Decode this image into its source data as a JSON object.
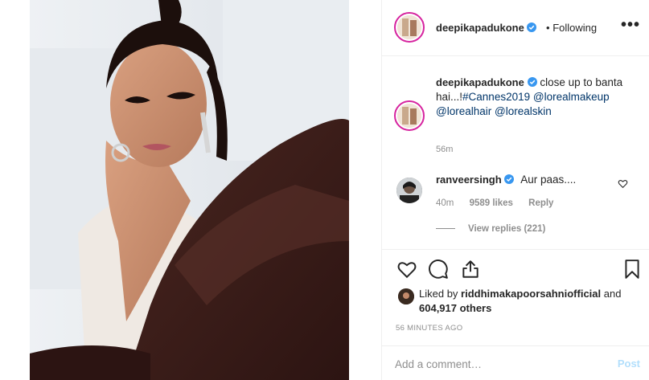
{
  "header": {
    "username": "deepikapadukone",
    "separator": "•",
    "follow_status": "Following",
    "more": "•••"
  },
  "caption": {
    "username": "deepikapadukone",
    "text": "close up to banta hai...!",
    "hashtag": "#Cannes2019",
    "mention1": "@lorealmakeup",
    "mention2": "@lorealhair",
    "mention3": "@lorealskin",
    "time": "56m"
  },
  "comment": {
    "username": "ranveersingh",
    "text": "Aur paas....",
    "time": "40m",
    "likes": "9589 likes",
    "reply": "Reply",
    "view_replies": "View replies (221)"
  },
  "likes": {
    "prefix": "Liked by",
    "user": "riddhimakapoorsahniofficial",
    "and": "and",
    "count": "604,917 others"
  },
  "post_age": "56 MINUTES AGO",
  "add_comment": {
    "placeholder": "Add a comment…",
    "post_label": "Post"
  },
  "colors": {
    "verified": "#3897f0",
    "link": "#003569",
    "post_button_disabled": "#b2dffc",
    "story_ring": "#d6249f"
  }
}
